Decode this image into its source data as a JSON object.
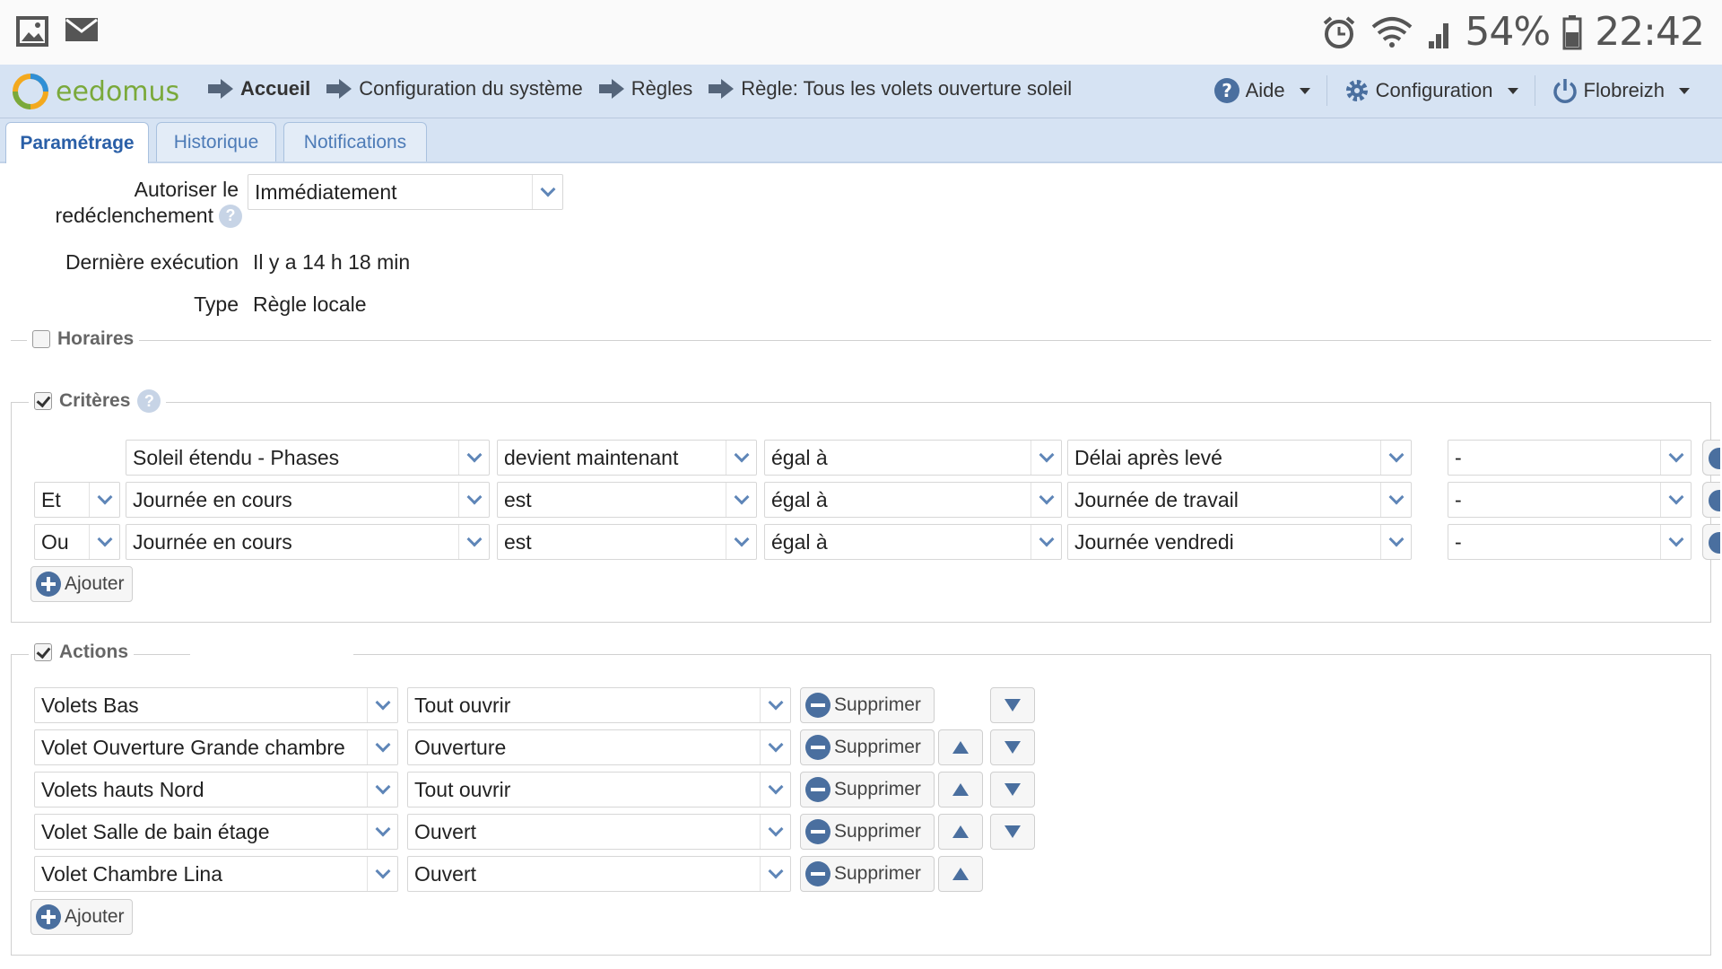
{
  "status_bar": {
    "battery": "54%",
    "time": "22:42"
  },
  "header": {
    "logo_text": "eedomus",
    "breadcrumbs": [
      "Accueil",
      "Configuration du système",
      "Règles",
      "Règle: Tous les volets ouverture soleil"
    ],
    "nav": {
      "help": "Aide",
      "config": "Configuration",
      "user": "Flobreizh"
    }
  },
  "tabs": [
    "Paramétrage",
    "Historique",
    "Notifications"
  ],
  "form": {
    "retrigger_label_1": "Autoriser le",
    "retrigger_label_2": "redéclenchement",
    "retrigger_value": "Immédiatement",
    "last_exec_label": "Dernière exécution",
    "last_exec_value": "Il y a 14 h 18 min",
    "type_label": "Type",
    "type_value": "Règle locale"
  },
  "sections": {
    "horaires": {
      "label": "Horaires",
      "checked": false
    },
    "criteres": {
      "label": "Critères",
      "checked": true
    },
    "actions": {
      "label": "Actions",
      "checked": true
    }
  },
  "criteria": [
    {
      "op": "",
      "device": "Soleil étendu - Phases",
      "cond": "devient maintenant",
      "cmp": "égal à",
      "value": "Délai après levé",
      "extra": "-"
    },
    {
      "op": "Et",
      "device": "Journée en cours",
      "cond": "est",
      "cmp": "égal à",
      "value": "Journée de travail",
      "extra": "-"
    },
    {
      "op": "Ou",
      "device": "Journée en cours",
      "cond": "est",
      "cmp": "égal à",
      "value": "Journée vendredi",
      "extra": "-"
    }
  ],
  "actions": [
    {
      "device": "Volets Bas",
      "value": "Tout ouvrir"
    },
    {
      "device": "Volet Ouverture Grande chambre",
      "value": "Ouverture"
    },
    {
      "device": "Volets hauts Nord",
      "value": "Tout ouvrir"
    },
    {
      "device": "Volet Salle de bain étage",
      "value": "Ouvert"
    },
    {
      "device": "Volet Chambre Lina",
      "value": "Ouvert"
    }
  ],
  "buttons": {
    "add": "Ajouter",
    "delete": "Supprimer"
  },
  "colors": {
    "nav_bg": "#d6e3f3",
    "accent": "#4a6f9f",
    "logo_green": "#7aa93b"
  }
}
